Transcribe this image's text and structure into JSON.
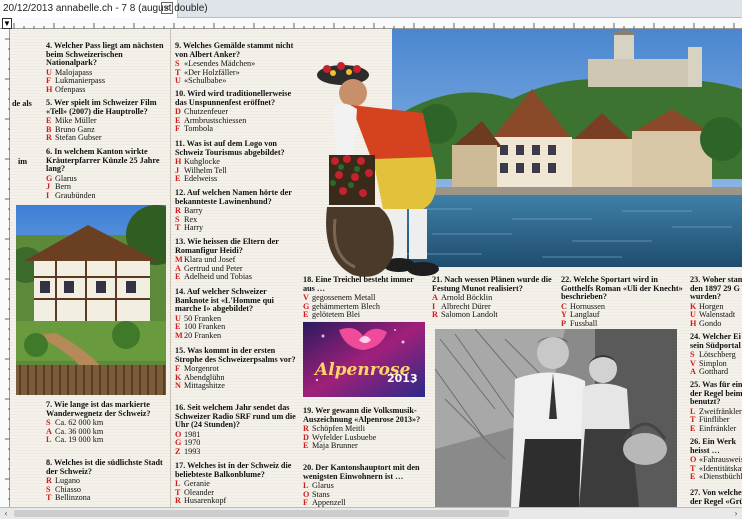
{
  "window": {
    "tab_title": "20/12/2013 annabelle.ch - 7 8 (august double)",
    "close_glyph": "×"
  },
  "ruler": {
    "marker": "▼"
  },
  "scrollbar": {
    "left_arrow": "‹",
    "right_arrow": "›"
  },
  "fragments": {
    "left1": "de als",
    "left2": "im"
  },
  "q4": {
    "title": "4. Welcher Pass liegt am nächsten beim Schweizerischen Nationalpark?",
    "options": [
      {
        "letter": "U",
        "text": "Malojapass"
      },
      {
        "letter": "F",
        "text": "Lukmanierpass"
      },
      {
        "letter": "H",
        "text": "Ofenpass"
      }
    ]
  },
  "q5": {
    "title": "5. Wer spielt im Schweizer Film «Tell» (2007) die Hauptrolle?",
    "options": [
      {
        "letter": "E",
        "text": "Mike Müller"
      },
      {
        "letter": "B",
        "text": "Bruno Ganz"
      },
      {
        "letter": "R",
        "text": "Stefan Gubser"
      }
    ]
  },
  "q6": {
    "title": "6. In welchem Kanton wirkte Kräuterpfarrer Künzle 25 Jahre lang?",
    "options": [
      {
        "letter": "G",
        "text": "Glarus"
      },
      {
        "letter": "J",
        "text": "Bern"
      },
      {
        "letter": "I",
        "text": "Graubünden"
      }
    ]
  },
  "q7": {
    "title": "7. Wie lange ist das markierte Wanderwegnetz der Schweiz?",
    "options": [
      {
        "letter": "S",
        "text": "Ca. 62 000 km"
      },
      {
        "letter": "A",
        "text": "Ca. 36 000 km"
      },
      {
        "letter": "L",
        "text": "Ca. 19 000 km"
      }
    ]
  },
  "q8": {
    "title": "8. Welches ist die südlichste Stadt der Schweiz?",
    "options": [
      {
        "letter": "R",
        "text": "Lugano"
      },
      {
        "letter": "S",
        "text": "Chiasso"
      },
      {
        "letter": "T",
        "text": "Bellinzona"
      }
    ]
  },
  "q9": {
    "title": "9. Welches Gemälde stammt nicht von Albert Anker?",
    "options": [
      {
        "letter": "S",
        "text": "«Lesendes Mädchen»"
      },
      {
        "letter": "T",
        "text": "«Der Holzfäller»"
      },
      {
        "letter": "U",
        "text": "«Schulbabe»"
      }
    ]
  },
  "q10": {
    "title": "10. Wird wird traditionellerweise das Unspunnenfest eröffnet?",
    "options": [
      {
        "letter": "D",
        "text": "Chutzenfeuer"
      },
      {
        "letter": "E",
        "text": "Armbrustschiessen"
      },
      {
        "letter": "F",
        "text": "Tombola"
      }
    ]
  },
  "q11": {
    "title": "11. Was ist auf dem Logo von Schweiz Tourismus abgebildet?",
    "options": [
      {
        "letter": "H",
        "text": "Kuhglocke"
      },
      {
        "letter": "J",
        "text": "Wilhelm Tell"
      },
      {
        "letter": "E",
        "text": "Edelweiss"
      }
    ]
  },
  "q12": {
    "title": "12. Auf welchen Namen hörte der bekannteste Lawinenhund?",
    "options": [
      {
        "letter": "R",
        "text": "Barry"
      },
      {
        "letter": "S",
        "text": "Rex"
      },
      {
        "letter": "T",
        "text": "Harry"
      }
    ]
  },
  "q13": {
    "title": "13. Wie heissen die Eltern der Romanfigur Heidi?",
    "options": [
      {
        "letter": "M",
        "text": "Klara und Josef"
      },
      {
        "letter": "A",
        "text": "Gertrud und Peter"
      },
      {
        "letter": "E",
        "text": "Adelheid und Tobias"
      }
    ]
  },
  "q14": {
    "title": "14. Auf welcher Schweizer Banknote ist «L'Homme qui marche I» abgebildet?",
    "options": [
      {
        "letter": "U",
        "text": "50 Franken"
      },
      {
        "letter": "E",
        "text": "100 Franken"
      },
      {
        "letter": "M",
        "text": "20 Franken"
      }
    ]
  },
  "q15": {
    "title": "15. Was kommt in der ersten Strophe des Schweizerpsalms vor?",
    "options": [
      {
        "letter": "F",
        "text": "Morgenrot"
      },
      {
        "letter": "K",
        "text": "Abendglühn"
      },
      {
        "letter": "N",
        "text": "Mittagshitze"
      }
    ]
  },
  "q16": {
    "title": "16. Seit welchem Jahr sendet das Schweizer Radio SRF rund um die Uhr (24 Stunden)?",
    "options": [
      {
        "letter": "O",
        "text": "1981"
      },
      {
        "letter": "G",
        "text": "1970"
      },
      {
        "letter": "Z",
        "text": "1993"
      }
    ]
  },
  "q17": {
    "title": "17. Welches ist in der Schweiz die beliebteste Balkonblume?",
    "options": [
      {
        "letter": "L",
        "text": "Geranie"
      },
      {
        "letter": "T",
        "text": "Oleander"
      },
      {
        "letter": "R",
        "text": "Husarenkopf"
      }
    ]
  },
  "q18": {
    "title": "18. Eine Treichel besteht immer aus …",
    "options": [
      {
        "letter": "V",
        "text": "gegossenem Metall"
      },
      {
        "letter": "G",
        "text": "gehämmertem Blech"
      },
      {
        "letter": "E",
        "text": "gelötetem Blei"
      }
    ]
  },
  "q19": {
    "title": "19. Wer gewann die Volksmusik-Auszeichnung «Alpenrose 2013»?",
    "options": [
      {
        "letter": "R",
        "text": "Schöpfen Meitli"
      },
      {
        "letter": "D",
        "text": "Wyfelder Lusbuebe"
      },
      {
        "letter": "E",
        "text": "Maja Brunner"
      }
    ]
  },
  "q20": {
    "title": "20. Der Kantonshauptort mit den wenigsten Einwohnern ist …",
    "options": [
      {
        "letter": "L",
        "text": "Glarus"
      },
      {
        "letter": "O",
        "text": "Stans"
      },
      {
        "letter": "F",
        "text": "Appenzell"
      }
    ]
  },
  "q21": {
    "title": "21. Nach wessen Plänen wurde die Festung Munot realisiert?",
    "options": [
      {
        "letter": "A",
        "text": "Arnold Böcklin"
      },
      {
        "letter": "I",
        "text": "Albrecht Dürer"
      },
      {
        "letter": "R",
        "text": "Salomon Landolt"
      }
    ]
  },
  "q22": {
    "title": "22. Welche Sportart wird in Gotthelfs Roman «Uli der Knecht» beschrieben?",
    "options": [
      {
        "letter": "C",
        "text": "Hornussen"
      },
      {
        "letter": "Y",
        "text": "Langlauf"
      },
      {
        "letter": "P",
        "text": "Fussball"
      }
    ]
  },
  "q23": {
    "title": "23. Woher stam den 1897 29 G wurden?",
    "options": [
      {
        "letter": "K",
        "text": "Horgen"
      },
      {
        "letter": "U",
        "text": "Walenstadt"
      },
      {
        "letter": "H",
        "text": "Gondo"
      }
    ]
  },
  "q24": {
    "title": "24. Welcher Ei sein Südportal",
    "options": [
      {
        "letter": "S",
        "text": "Lötschberg"
      },
      {
        "letter": "V",
        "text": "Simplon"
      },
      {
        "letter": "A",
        "text": "Gotthard"
      }
    ]
  },
  "q25": {
    "title": "25. Was für ein der Regel beim benutzt?",
    "options": [
      {
        "letter": "L",
        "text": "Zweifränkler"
      },
      {
        "letter": "T",
        "text": "Fünfliber"
      },
      {
        "letter": "E",
        "text": "Einfränkler"
      }
    ]
  },
  "q26": {
    "title": "26. Ein Werk heisst …",
    "options": [
      {
        "letter": "O",
        "text": "«Fahrausweis"
      },
      {
        "letter": "T",
        "text": "«Identitätskar"
      },
      {
        "letter": "E",
        "text": "«Dienstbüchl"
      }
    ]
  },
  "q27": {
    "title": "27. Von welche der Regel «Grü"
  },
  "logo": {
    "text": "Alpenrose",
    "year": "2013"
  }
}
